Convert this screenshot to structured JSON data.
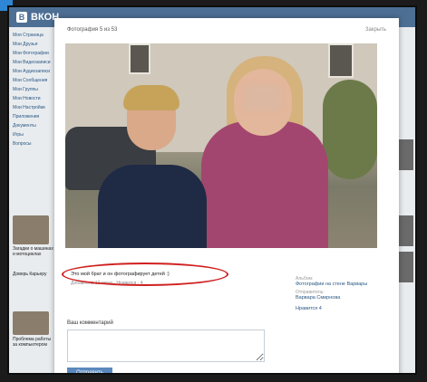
{
  "app": {
    "logo_text": "ВКОН"
  },
  "left_menu": {
    "items": [
      "Моя Страница",
      "Мои Друзья",
      "Мои Фотографии",
      "Мои Видеозаписи",
      "Мои Аудиозаписи",
      "Мои Сообщения",
      "Мои Группы",
      "Мои Новости",
      "Мои Настройки",
      "Приложения",
      "Документы",
      "Игры",
      "Вопросы"
    ]
  },
  "modal": {
    "photo_counter": "Фотография 5 из 53",
    "close_label": "Закрыть",
    "caption": "Это мой брат и он фотографирует детей :)",
    "caption_meta": "Добавлена 12 июня · Нравится · 4",
    "album_label": "Альбом:",
    "album_value": "Фотографии на стене Варвары",
    "uploaded_label": "Отправитель:",
    "uploaded_value": "Варвара Смирнова",
    "likes_label": "Нравится 4",
    "comment_label": "Ваш комментарий",
    "comment_placeholder": "",
    "send_label": "Отправить"
  },
  "left_blocks": [
    {
      "caption": "Загадки о машинах и мотоциклах"
    },
    {
      "caption": "Доверь Карьеру"
    },
    {
      "caption": "Проблема работы за компьютером"
    }
  ],
  "colors": {
    "header_blue": "#4d6f94",
    "button_blue": "#5b88bd",
    "highlight_red": "#d02020"
  }
}
